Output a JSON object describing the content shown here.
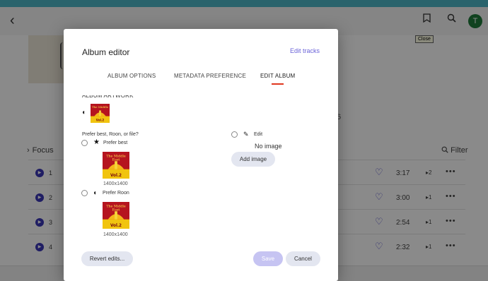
{
  "app": {
    "tooltip": "Close",
    "avatar_initial": "T",
    "focus_label": "Focus",
    "filter_label": "Filter",
    "stray_number": "6",
    "icons": {
      "back": "arrow-left-icon",
      "bookmark": "bookmark-icon",
      "search": "search-icon",
      "filter": "search-icon"
    },
    "tracks": [
      {
        "num": "1",
        "duration": "3:17",
        "count": "2"
      },
      {
        "num": "2",
        "duration": "3:00",
        "count": "1"
      },
      {
        "num": "3",
        "duration": "2:54",
        "count": "1"
      },
      {
        "num": "4",
        "duration": "2:32",
        "count": "1"
      }
    ]
  },
  "modal": {
    "title": "Album editor",
    "edit_tracks": "Edit tracks",
    "tabs": [
      {
        "label": "ALBUM OPTIONS"
      },
      {
        "label": "METADATA PREFERENCE"
      },
      {
        "label": "EDIT ALBUM",
        "active": true
      }
    ],
    "artwork_section": "ALBUM ARTWORK",
    "prefer_question": "Prefer best, Roon, or file?",
    "options": {
      "best": {
        "label": "Prefer best",
        "resolution": "1400x1400"
      },
      "roon": {
        "label": "Prefer Roon",
        "resolution": "1400x1400"
      },
      "edit": {
        "label": "Edit",
        "no_image": "No image",
        "add_image": "Add image"
      }
    },
    "buttons": {
      "revert": "Revert edits...",
      "save": "Save",
      "cancel": "Cancel"
    },
    "album_art": {
      "line1": "The Middle",
      "line2": "East",
      "line3": "Vol.2"
    }
  },
  "colors": {
    "accent": "#6b63d8",
    "tab_underline": "#e0371f",
    "play_button": "#3a36b8",
    "top_strip": "#4fb8c8"
  }
}
